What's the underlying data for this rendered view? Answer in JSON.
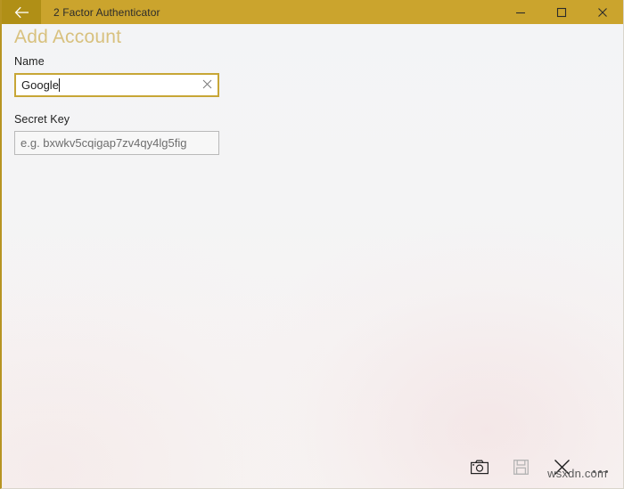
{
  "window": {
    "title": "2 Factor Authenticator",
    "back_icon": "back-arrow-icon",
    "controls": {
      "minimize": "minimize-icon",
      "maximize": "maximize-icon",
      "close": "close-icon"
    },
    "titlebar_color": "#cba42d",
    "back_button_color": "#b08f16"
  },
  "page": {
    "title": "Add Account",
    "title_color": "#d8c17e"
  },
  "form": {
    "name_field": {
      "label": "Name",
      "value": "Google",
      "placeholder": "",
      "clear_icon": "close-icon",
      "focused": true,
      "border_color": "#c7a636"
    },
    "secret_field": {
      "label": "Secret Key",
      "value": "",
      "placeholder": "e.g. bxwkv5cqigap7zv4qy4lg5fig",
      "focused": false,
      "border_color": "#b9b9b9"
    }
  },
  "command_bar": {
    "buttons": [
      {
        "name": "scan-qr-code-button",
        "icon": "camera-icon",
        "enabled": true
      },
      {
        "name": "save-button",
        "icon": "floppy-disk-save-icon",
        "enabled": false
      },
      {
        "name": "cancel-button",
        "icon": "close-icon",
        "enabled": true
      },
      {
        "name": "overflow-menu-button",
        "icon": "ellipsis-icon",
        "enabled": true
      }
    ]
  },
  "watermark": {
    "text": "wsxdn.com"
  }
}
